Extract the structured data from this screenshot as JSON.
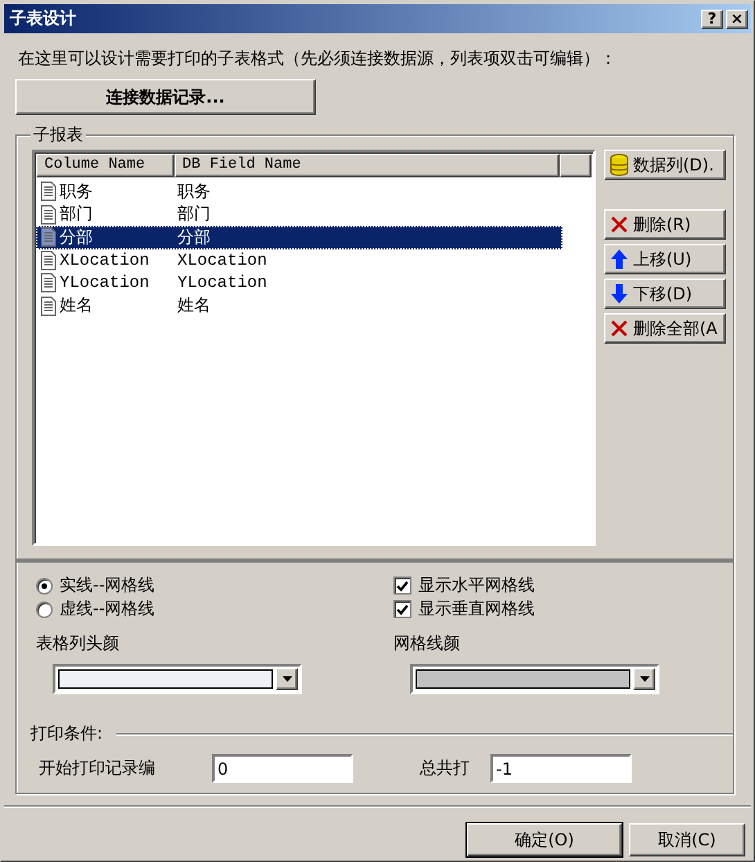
{
  "window": {
    "title": "子表设计",
    "help": "?",
    "close": "×"
  },
  "description": "在这里可以设计需要打印的子表格式（先必须连接数据源，列表项双击可编辑）：",
  "connect_button": "连接数据记录...",
  "group_title": "子报表",
  "table": {
    "columns": [
      "Colume Name",
      "DB Field Name"
    ],
    "rows": [
      {
        "name": "职务",
        "field": "职务",
        "selected": false
      },
      {
        "name": "部门",
        "field": "部门",
        "selected": false
      },
      {
        "name": "分部",
        "field": "分部",
        "selected": true
      },
      {
        "name": "XLocation",
        "field": "XLocation",
        "selected": false
      },
      {
        "name": "YLocation",
        "field": "YLocation",
        "selected": false
      },
      {
        "name": "姓名",
        "field": "姓名",
        "selected": false
      }
    ]
  },
  "side_buttons": [
    "数据列(D).",
    "删除(R)",
    "上移(U)",
    "下移(D)",
    "删除全部(A"
  ],
  "line_styles": [
    {
      "label": "实线--网格线",
      "selected": true
    },
    {
      "label": "虚线--网格线",
      "selected": false
    }
  ],
  "grid_options": [
    {
      "label": "显示水平网格线",
      "checked": true
    },
    {
      "label": "显示垂直网格线",
      "checked": true
    }
  ],
  "header_color": {
    "label": "表格列头颜",
    "color": "#eef2f7"
  },
  "grid_color": {
    "label": "网格线颜",
    "color": "#c0c0c0"
  },
  "print_conditions": {
    "title": "打印条件:",
    "start_label": "开始打印记录编",
    "start_value": "0",
    "total_label": "总共打",
    "total_value": "-1"
  },
  "buttons": [
    "确定(O)",
    "取消(C)"
  ]
}
